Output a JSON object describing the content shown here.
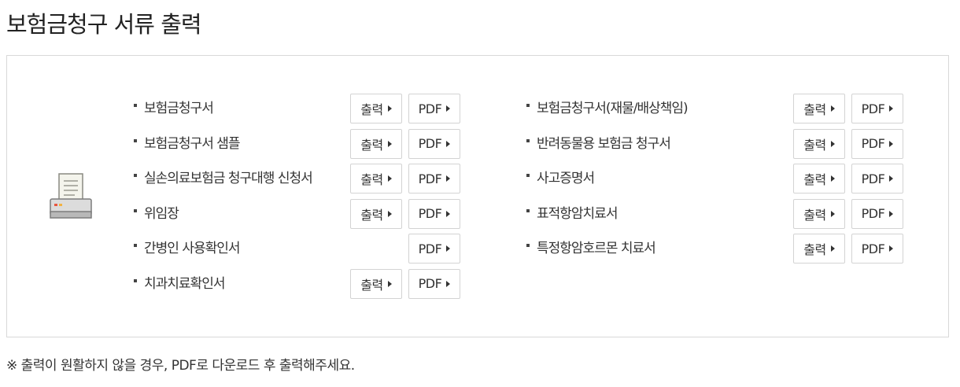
{
  "page": {
    "title": "보험금청구 서류 출력"
  },
  "buttons": {
    "print_label": "출력",
    "pdf_label": "PDF"
  },
  "left_column": [
    {
      "name": "보험금청구서",
      "has_print": true,
      "has_pdf": true
    },
    {
      "name": "보험금청구서 샘플",
      "has_print": true,
      "has_pdf": true
    },
    {
      "name": "실손의료보험금 청구대행 신청서",
      "has_print": true,
      "has_pdf": true
    },
    {
      "name": "위임장",
      "has_print": true,
      "has_pdf": true
    },
    {
      "name": "간병인 사용확인서",
      "has_print": false,
      "has_pdf": true
    },
    {
      "name": "치과치료확인서",
      "has_print": true,
      "has_pdf": true
    }
  ],
  "right_column": [
    {
      "name": "보험금청구서(재물/배상책임)",
      "has_print": true,
      "has_pdf": true
    },
    {
      "name": "반려동물용 보험금 청구서",
      "has_print": true,
      "has_pdf": true
    },
    {
      "name": "사고증명서",
      "has_print": true,
      "has_pdf": true
    },
    {
      "name": "표적항암치료서",
      "has_print": true,
      "has_pdf": true
    },
    {
      "name": "특정항암호르몬 치료서",
      "has_print": true,
      "has_pdf": true
    }
  ],
  "notice": {
    "text": "※ 출력이 원활하지 않을 경우, PDF로 다운로드 후 출력해주세요."
  },
  "icons": {
    "printer": "printer-icon",
    "arrow": "arrow-right-icon"
  },
  "colors": {
    "border": "#d9d9d9",
    "button_border": "#d3d3d3",
    "text": "#333333",
    "printer_body": "#d6d6d6",
    "printer_paper": "#f2f2ea",
    "printer_light": "#e8553f"
  }
}
